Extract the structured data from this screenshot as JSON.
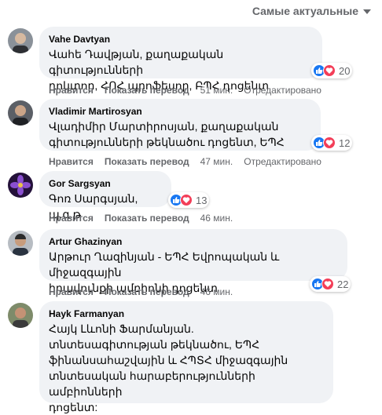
{
  "sort": {
    "label": "Самые актуальные"
  },
  "labels": {
    "like": "Нравится",
    "translate": "Показать перевод",
    "edited": "Отредактировано"
  },
  "comments": [
    {
      "author": "Vahe Davtyan",
      "text": "Վահե Դավթյան, քաղաքական գիտությունների\nդոկտոր, ՀՈՀ պրոֆեսոր, ԲՊՀ դոցենտ",
      "reactions": "20",
      "time": "51 мин.",
      "edited": true
    },
    {
      "author": "Vladimir Martirosyan",
      "text": "Վլադիմիր Մարտիրոսյան, քաղաքական\nգիտությունների թեկնածու դոցենտ, ԵՊՀ",
      "reactions": "12",
      "time": "47 мин.",
      "edited": true
    },
    {
      "author": "Gor Sargsyan",
      "text": "Գոռ Սարգսյան, պ.գ.թ",
      "reactions": "13",
      "time": "46 мин.",
      "edited": false
    },
    {
      "author": "Artur Ghazinyan",
      "text": "Արթուր Ղազինյան - ԵՊՀ Եվրոպական և միջազգային\nիրավունքի ամբիոնի դոցենտ",
      "reactions": "22",
      "time": "46 мин.",
      "edited": false
    },
    {
      "author": "Hayk Farmanyan",
      "text": "Հայկ Լևոնի Ֆարմանյան.\nտնտեսագիտության թեկնածու, ԵՊՀ\nֆինանսահաշվային և ՀՊՏՀ միջազգային\nտնտեսական հարաբերությունների ամբիոնների\nդոցենտ:",
      "reactions": "",
      "time": "",
      "edited": false
    }
  ]
}
